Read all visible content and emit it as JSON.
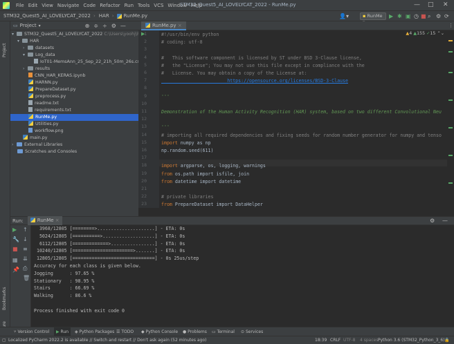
{
  "menubar": {
    "items": [
      "File",
      "Edit",
      "View",
      "Navigate",
      "Code",
      "Refactor",
      "Run",
      "Tools",
      "VCS",
      "Window",
      "Help"
    ],
    "title": "STM32_Quest5_AI_LOVELYCAT_2022 - RunMe.py"
  },
  "navbar": {
    "crumbs": [
      "STM32_Quest5_AI_LOVELYCAT_2022",
      "HAR",
      "RunMe.py"
    ],
    "run_config": "RunMe"
  },
  "project": {
    "title": "Project",
    "root": "STM32_Quest5_AI_LOVELYCAT_2022",
    "root_path": "C:\\Users\\yoohj\\Py",
    "items": [
      "HAR",
      "datasets",
      "Log_data",
      "IoT01-MemsAnn_25_Sep_22_21h_50m_26s.csv",
      "results",
      "CNN_HAR_KERAS.ipynb",
      "HARNN.py",
      "PrepareDataset.py",
      "preprocess.py",
      "readme.txt",
      "requirements.txt",
      "RunMe.py",
      "Utilities.py",
      "workflow.png",
      "main.py",
      "External Libraries",
      "Scratches and Consoles"
    ]
  },
  "side_labels": {
    "project": "Project",
    "bookmarks": "Bookmarks",
    "structure": "Structure"
  },
  "editor": {
    "tab": "RunMe.py",
    "inspections": {
      "warnings": "4",
      "weak": "155",
      "typos": "15"
    },
    "line_numbers": [
      "1",
      "2",
      "3",
      "4",
      "5",
      "6",
      "7",
      "8",
      "9",
      "10",
      "11",
      "12",
      "13",
      "14",
      "15",
      "16",
      "17",
      "18",
      "19",
      "20",
      "21",
      "22",
      "23"
    ],
    "lines": [
      "#!/usr/bin/env python",
      "# coding: utf-8",
      "",
      "#   This software component is licensed by ST under BSD 3-Clause license,",
      "#   the \"License\"; You may not use this file except in compliance with the",
      "#   License. You may obtain a copy of the License at:",
      "                        https://opensource.org/licenses/BSD-3-Clause",
      "",
      "'''",
      "",
      "Demonstration of the Human Activity Recognition (HAR) system, based on two different Convolutional Neu",
      "",
      "'''",
      "# importing all required dependencies and fixing seeds for random number generator for numpy and tenso",
      "import numpy as np",
      "np.random.seed(611)",
      "",
      "import argparse, os, logging, warnings",
      "from os.path import isfile, join",
      "from datetime import datetime",
      "",
      "# private libraries",
      "from PrepareDataset import DataHelper"
    ]
  },
  "run": {
    "label": "Run:",
    "tab": "RunMe",
    "console": [
      "  3968/12805 [========>.....................] - ETA: 0s",
      "  5024/12805 [==========>...................] - ETA: 0s",
      "  6112/12805 [=============>................] - ETA: 0s",
      " 10240/12805 [======================>.......] - ETA: 0s",
      " 12805/12805 [==============================] - 0s 25us/step",
      "Accuracy for each class is given below.",
      "Jogging      : 97.65 %",
      "Stationary   : 98.95 %",
      "Stairs       : 66.69 %",
      "Walking      : 86.6 %",
      "",
      "Process finished with exit code 0"
    ]
  },
  "bottom_tools": [
    "Version Control",
    "Run",
    "Python Packages",
    "TODO",
    "Python Console",
    "Problems",
    "Terminal",
    "Services"
  ],
  "status": {
    "message": "Localized PyCharm 2022.2 is available // Switch and restart // Don't ask again (52 minutes ago)",
    "position": "18:39",
    "line_sep": "CRLF",
    "encoding": "UTF-8",
    "indent": "4 spaces",
    "interpreter": "Python 3.6 (STM32_Python_3_6)"
  }
}
